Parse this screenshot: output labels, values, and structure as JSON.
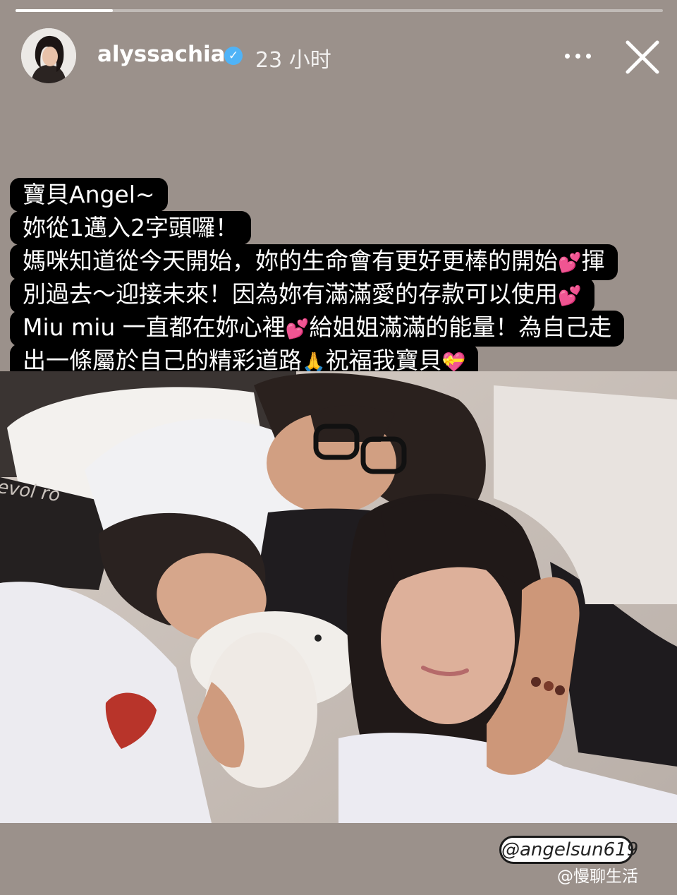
{
  "story": {
    "progress_fraction": 0.15,
    "username": "alyssachia",
    "verified_icon": "verified-check-icon",
    "time": "23 小时",
    "more_icon": "more-dots-icon",
    "close_icon": "close-icon"
  },
  "caption": {
    "line1": "寶貝Angel~",
    "line2": "妳從1邁入2字頭囉！",
    "line3_a": "媽咪知道從今天開始，妳的生命會有更好更棒的開始",
    "line3_b": "揮",
    "line4_a": "別過去～迎接未來！因為妳有滿滿愛的存款可以使用",
    "line5_a": "Miu miu 一直都在妳心裡",
    "line5_b": "給姐姐滿滿的能量！為自己走",
    "line6_a": "出一條屬於自己的精彩道路",
    "line6_b": "祝福我寶貝",
    "heart_emoji": "💕",
    "pray_emoji": "🙏",
    "gift_emoji": "💝"
  },
  "photo": {
    "shirt_text": "evol ro"
  },
  "mention": {
    "label": "@angelsun619"
  },
  "watermark": {
    "text": "@慢聊生活"
  },
  "colors": {
    "background": "#9b918b",
    "caption_bg": "#000000",
    "heart": "#ff55b4",
    "verified": "#4fb3f7"
  }
}
